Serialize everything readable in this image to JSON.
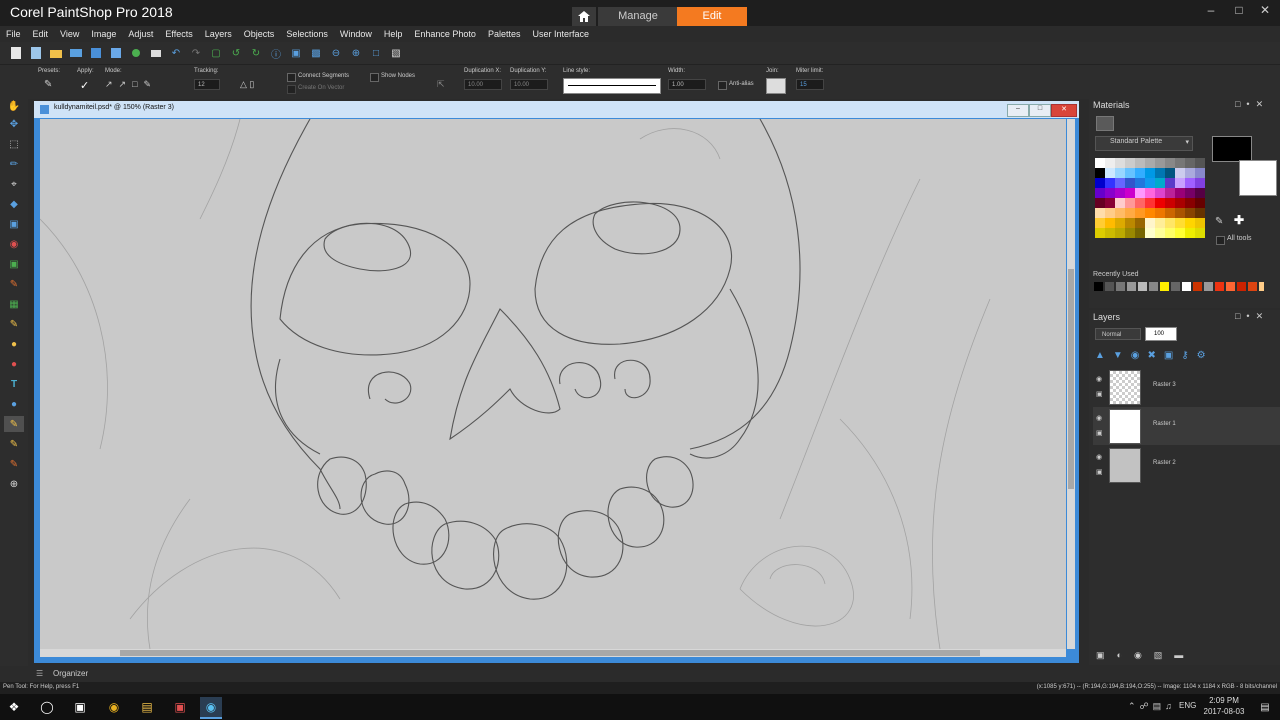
{
  "app": {
    "title": "Corel PaintShop Pro 2018",
    "tabs": {
      "manage": "Manage",
      "edit": "Edit"
    }
  },
  "menu": [
    "File",
    "Edit",
    "View",
    "Image",
    "Adjust",
    "Effects",
    "Layers",
    "Objects",
    "Selections",
    "Window",
    "Help",
    "Enhance Photo",
    "Palettes",
    "User Interface"
  ],
  "options": {
    "presets_label": "Presets:",
    "apply_label": "Apply:",
    "mode_label": "Mode:",
    "tracking_label": "Tracking:",
    "tracking_value": "12",
    "connect_segments": "Connect Segments",
    "create_on_vector": "Create On Vector",
    "show_nodes": "Show Nodes",
    "duplication_x_label": "Duplication X:",
    "duplication_x_value": "10.00",
    "duplication_y_label": "Duplication Y:",
    "duplication_y_value": "10.00",
    "line_style_label": "Line style:",
    "width_label": "Width:",
    "width_value": "1.00",
    "anti_alias": "Anti-alias",
    "join_label": "Join:",
    "miter_limit_label": "Miter limit:",
    "miter_limit_value": "15"
  },
  "document": {
    "title": "kulldynamiteil.psd* @ 150% (Raster 3)"
  },
  "materials": {
    "title": "Materials",
    "palette": "Standard Palette",
    "recently_used": "Recently Used",
    "all_tools": "All tools",
    "foreground_color": "#000000",
    "background_color": "#ffffff"
  },
  "layers": {
    "title": "Layers",
    "blend_mode": "Normal",
    "opacity": "100",
    "items": [
      {
        "name": "Raster 3"
      },
      {
        "name": "Raster 1"
      },
      {
        "name": "Raster 2"
      }
    ]
  },
  "organizer": {
    "label": "Organizer"
  },
  "status": {
    "left": "Pen Tool: For Help, press F1",
    "right": "(x:1085 y:671) -- (R:194,G:194,B:194,O:255) -- Image: 1104 x 1184 x RGB - 8 bits/channel"
  },
  "taskbar": {
    "lang": "ENG",
    "time": "2:09 PM",
    "date": "2017-08-03"
  },
  "colors": {
    "accent": "#f47a20",
    "canvas": "#c9c9c9",
    "doc_border": "#3c8ad8"
  }
}
